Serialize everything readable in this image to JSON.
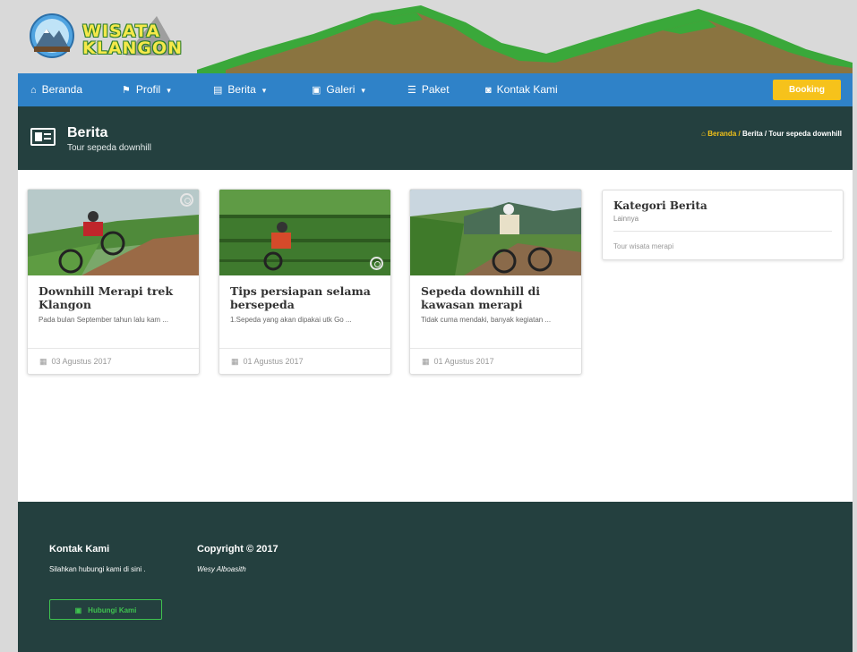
{
  "brand": {
    "line1": "WISATA",
    "line2": "KLANGON"
  },
  "nav": {
    "items": [
      {
        "label": "Beranda",
        "icon": "home-icon",
        "glyph": "⌂",
        "caret": ""
      },
      {
        "label": "Profil",
        "icon": "flag-icon",
        "glyph": "⚑",
        "caret": "▾"
      },
      {
        "label": "Berita",
        "icon": "newspaper-icon",
        "glyph": "▤",
        "caret": "▾"
      },
      {
        "label": "Galeri",
        "icon": "image-icon",
        "glyph": "▣",
        "caret": "▾"
      },
      {
        "label": "Paket",
        "icon": "list-icon",
        "glyph": "☰",
        "caret": ""
      },
      {
        "label": "Kontak Kami",
        "icon": "chat-icon",
        "glyph": "◙",
        "caret": ""
      }
    ],
    "booking": "Booking"
  },
  "page_header": {
    "title": "Berita",
    "subtitle": "Tour sepeda downhill",
    "breadcrumb": {
      "home": "Beranda",
      "sep": "/",
      "section": "Berita",
      "current": "Tour sepeda downhill"
    }
  },
  "cards": [
    {
      "title": "Downhill Merapi trek Klangon",
      "desc": "Pada bulan September tahun lalu kam ...",
      "date": "03 Agustus 2017"
    },
    {
      "title": "Tips persiapan selama bersepeda",
      "desc": "1.Sepeda yang akan dipakai utk Go ...",
      "date": "01 Agustus 2017"
    },
    {
      "title": "Sepeda downhill di kawasan merapi",
      "desc": "Tidak cuma mendaki, banyak kegiatan ...",
      "date": "01 Agustus 2017"
    }
  ],
  "sidebar": {
    "title": "Kategori Berita",
    "subtitle": "Lainnya",
    "link": "Tour wisata merapi"
  },
  "footer": {
    "contact_title": "Kontak Kami",
    "contact_text": "Silahkan hubungi kami di sini .",
    "button": "Hubungi Kami",
    "copyright": "Copyright © 2017",
    "author": "Wesy Alboasith"
  },
  "colors": {
    "navbar": "#2f82c8",
    "header_bg": "#24403f",
    "booking": "#f6c21b",
    "accent_green": "#3fc24f",
    "breadcrumb_gold": "#f0c019"
  }
}
